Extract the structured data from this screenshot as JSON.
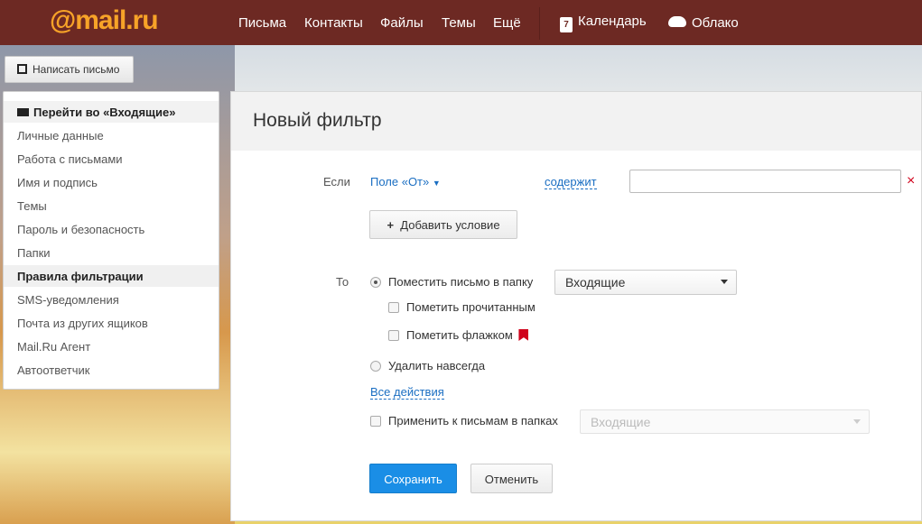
{
  "header": {
    "logo": "@mail.ru",
    "nav": [
      "Письма",
      "Контакты",
      "Файлы",
      "Темы",
      "Ещё"
    ],
    "calendar": "Календарь",
    "calendar_day": "7",
    "cloud": "Облако"
  },
  "compose_label": "Написать письмо",
  "sidebar": {
    "items": [
      "Перейти во «Входящие»",
      "Личные данные",
      "Работа с письмами",
      "Имя и подпись",
      "Темы",
      "Пароль и безопасность",
      "Папки",
      "Правила фильтрации",
      "SMS-уведомления",
      "Почта из других ящиков",
      "Mail.Ru Агент",
      "Автоответчик"
    ]
  },
  "main": {
    "title": "Новый фильтр",
    "if_label": "Если",
    "field_select": "Поле «От»",
    "condition": "содержит",
    "condition_value": "",
    "remove": "×",
    "add_condition": "Добавить условие",
    "then_label": "То",
    "move_to_folder": "Поместить письмо в папку",
    "folder_select": "Входящие",
    "mark_read": "Пометить прочитанным",
    "mark_flag": "Пометить флажком",
    "delete_forever": "Удалить навсегда",
    "all_actions": "Все действия",
    "apply_to_folders": "Применить к письмам в папках",
    "apply_folder_select": "Входящие",
    "save": "Сохранить",
    "cancel": "Отменить"
  },
  "colors": {
    "header": "#6d2923",
    "logo": "#f7a328",
    "primary": "#1a8ee6",
    "link": "#1a6ec2",
    "flag": "#d0021b"
  }
}
